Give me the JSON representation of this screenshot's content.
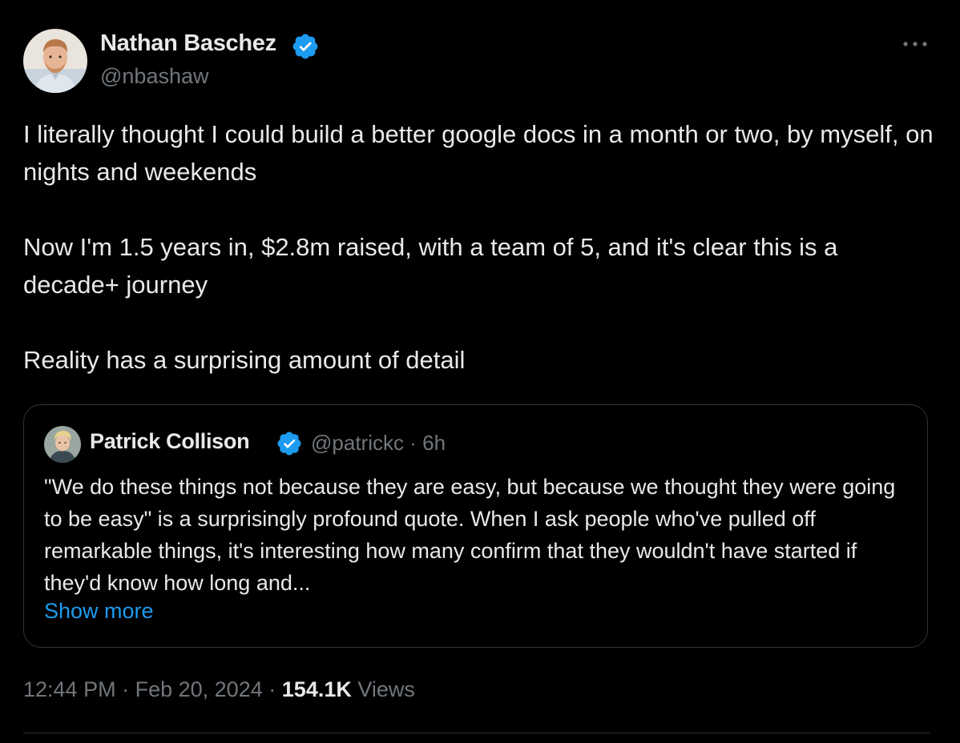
{
  "author": {
    "name": "Nathan Baschez",
    "handle": "@nbashaw",
    "verified": true,
    "avatar_icon": "person-avatar"
  },
  "tweet": {
    "paragraphs": [
      "I literally thought I could build a better google docs in a month or two, by myself, on nights and weekends",
      "Now I'm 1.5 years in, $2.8m raised, with a team of 5, and it's clear this is a decade+ journey",
      "Reality has a surprising amount of detail"
    ]
  },
  "quote": {
    "name": "Patrick Collison",
    "handle": "@patrickc",
    "separator": "·",
    "age": "6h",
    "verified": true,
    "text": "\"We do these things not because they are easy, but because we thought they were going to be easy\" is a surprisingly profound quote. When I ask people who've pulled off remarkable things, it's interesting how many confirm that they wouldn't have started if they'd know how long and...",
    "show_more_label": "Show more"
  },
  "meta": {
    "time": "12:44 PM",
    "separator": "·",
    "date": "Feb 20, 2024",
    "views_count": "154.1K",
    "views_label": "Views"
  },
  "colors": {
    "background": "#000000",
    "text_primary": "#e7e9ea",
    "text_secondary": "#71767b",
    "accent": "#1d9bf0",
    "border": "#2f3336"
  },
  "icons": {
    "verified": "verified-badge-icon",
    "more": "more-options-icon"
  }
}
